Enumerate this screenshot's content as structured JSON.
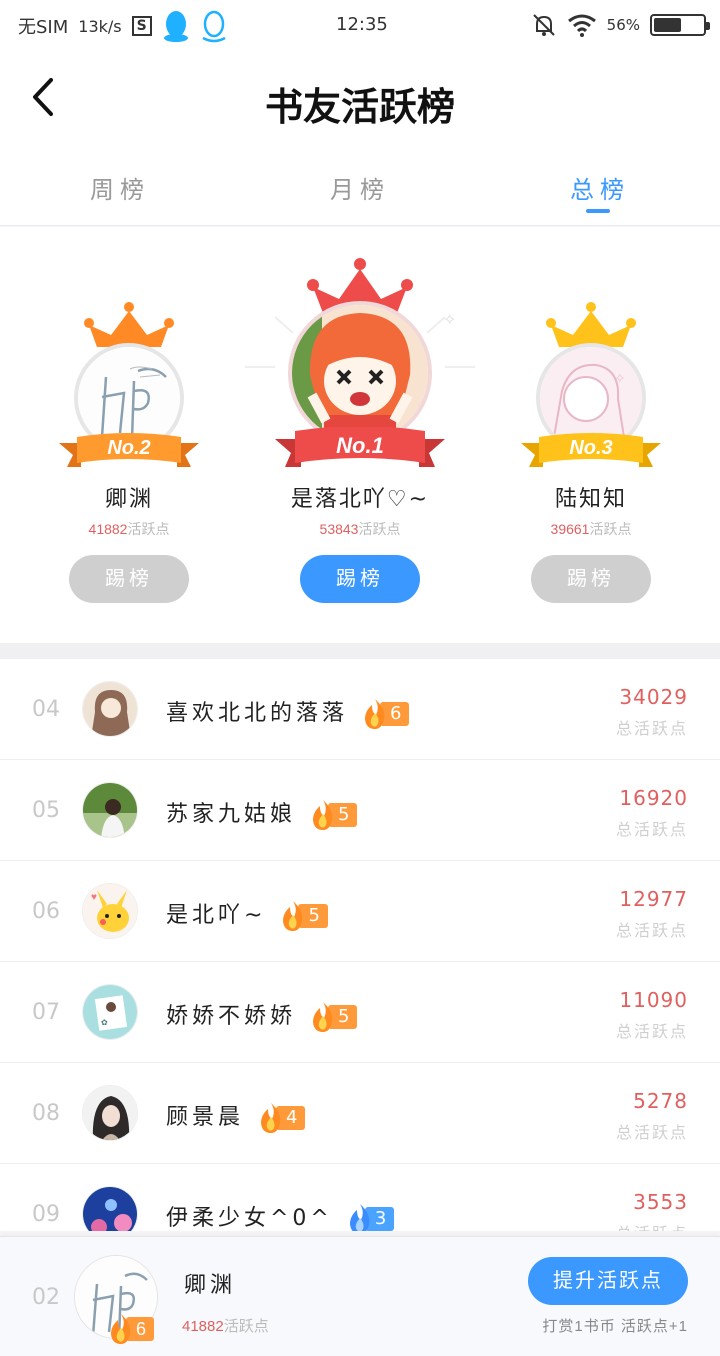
{
  "status_bar": {
    "carrier": "无SIM",
    "speed": "13k/s",
    "s_icon": "S",
    "time": "12:35",
    "battery": "56%",
    "battery_level": 0.56
  },
  "header": {
    "title": "书友活跃榜"
  },
  "tabs": [
    {
      "label": "周榜",
      "active": false
    },
    {
      "label": "月榜",
      "active": false
    },
    {
      "label": "总榜",
      "active": true
    }
  ],
  "podium": {
    "second": {
      "rank": "No.2",
      "name": "卿渊",
      "points": "41882",
      "points_label": "活跃点",
      "button": "踢榜"
    },
    "first": {
      "rank": "No.1",
      "name": "是落北吖♡~",
      "points": "53843",
      "points_label": "活跃点",
      "button": "踢榜"
    },
    "third": {
      "rank": "No.3",
      "name": "陆知知",
      "points": "39661",
      "points_label": "活跃点",
      "button": "踢榜"
    }
  },
  "list": [
    {
      "rank": "04",
      "name": "喜欢北北的落落",
      "level": "6",
      "level_color": "orange",
      "score": "34029",
      "score_label": "总活跃点"
    },
    {
      "rank": "05",
      "name": "苏家九姑娘",
      "level": "5",
      "level_color": "orange",
      "score": "16920",
      "score_label": "总活跃点"
    },
    {
      "rank": "06",
      "name": "是北吖~",
      "level": "5",
      "level_color": "orange",
      "score": "12977",
      "score_label": "总活跃点"
    },
    {
      "rank": "07",
      "name": "娇娇不娇娇",
      "level": "5",
      "level_color": "orange",
      "score": "11090",
      "score_label": "总活跃点"
    },
    {
      "rank": "08",
      "name": "顾景晨",
      "level": "4",
      "level_color": "orange",
      "score": "5278",
      "score_label": "总活跃点"
    },
    {
      "rank": "09",
      "name": "伊柔少女^0^",
      "level": "3",
      "level_color": "blue",
      "score": "3553",
      "score_label": "总活跃点"
    }
  ],
  "me": {
    "rank": "02",
    "name": "卿渊",
    "level": "6",
    "points": "41882",
    "points_label": "活跃点",
    "boost_button": "提升活跃点",
    "hint": "打赏1书币 活跃点+1"
  },
  "colors": {
    "accent": "#3a98ff",
    "score_red": "#e06060",
    "gold": "#ffc21a",
    "orange": "#ff9a3a",
    "first_red": "#ee4b4b"
  },
  "icons": {
    "back": "chevron-left-icon",
    "crown": "crown-icon",
    "flame": "flame-icon",
    "qq": "qq-penguin-icon",
    "mute": "bell-off-icon",
    "wifi": "wifi-icon",
    "battery": "battery-icon"
  }
}
